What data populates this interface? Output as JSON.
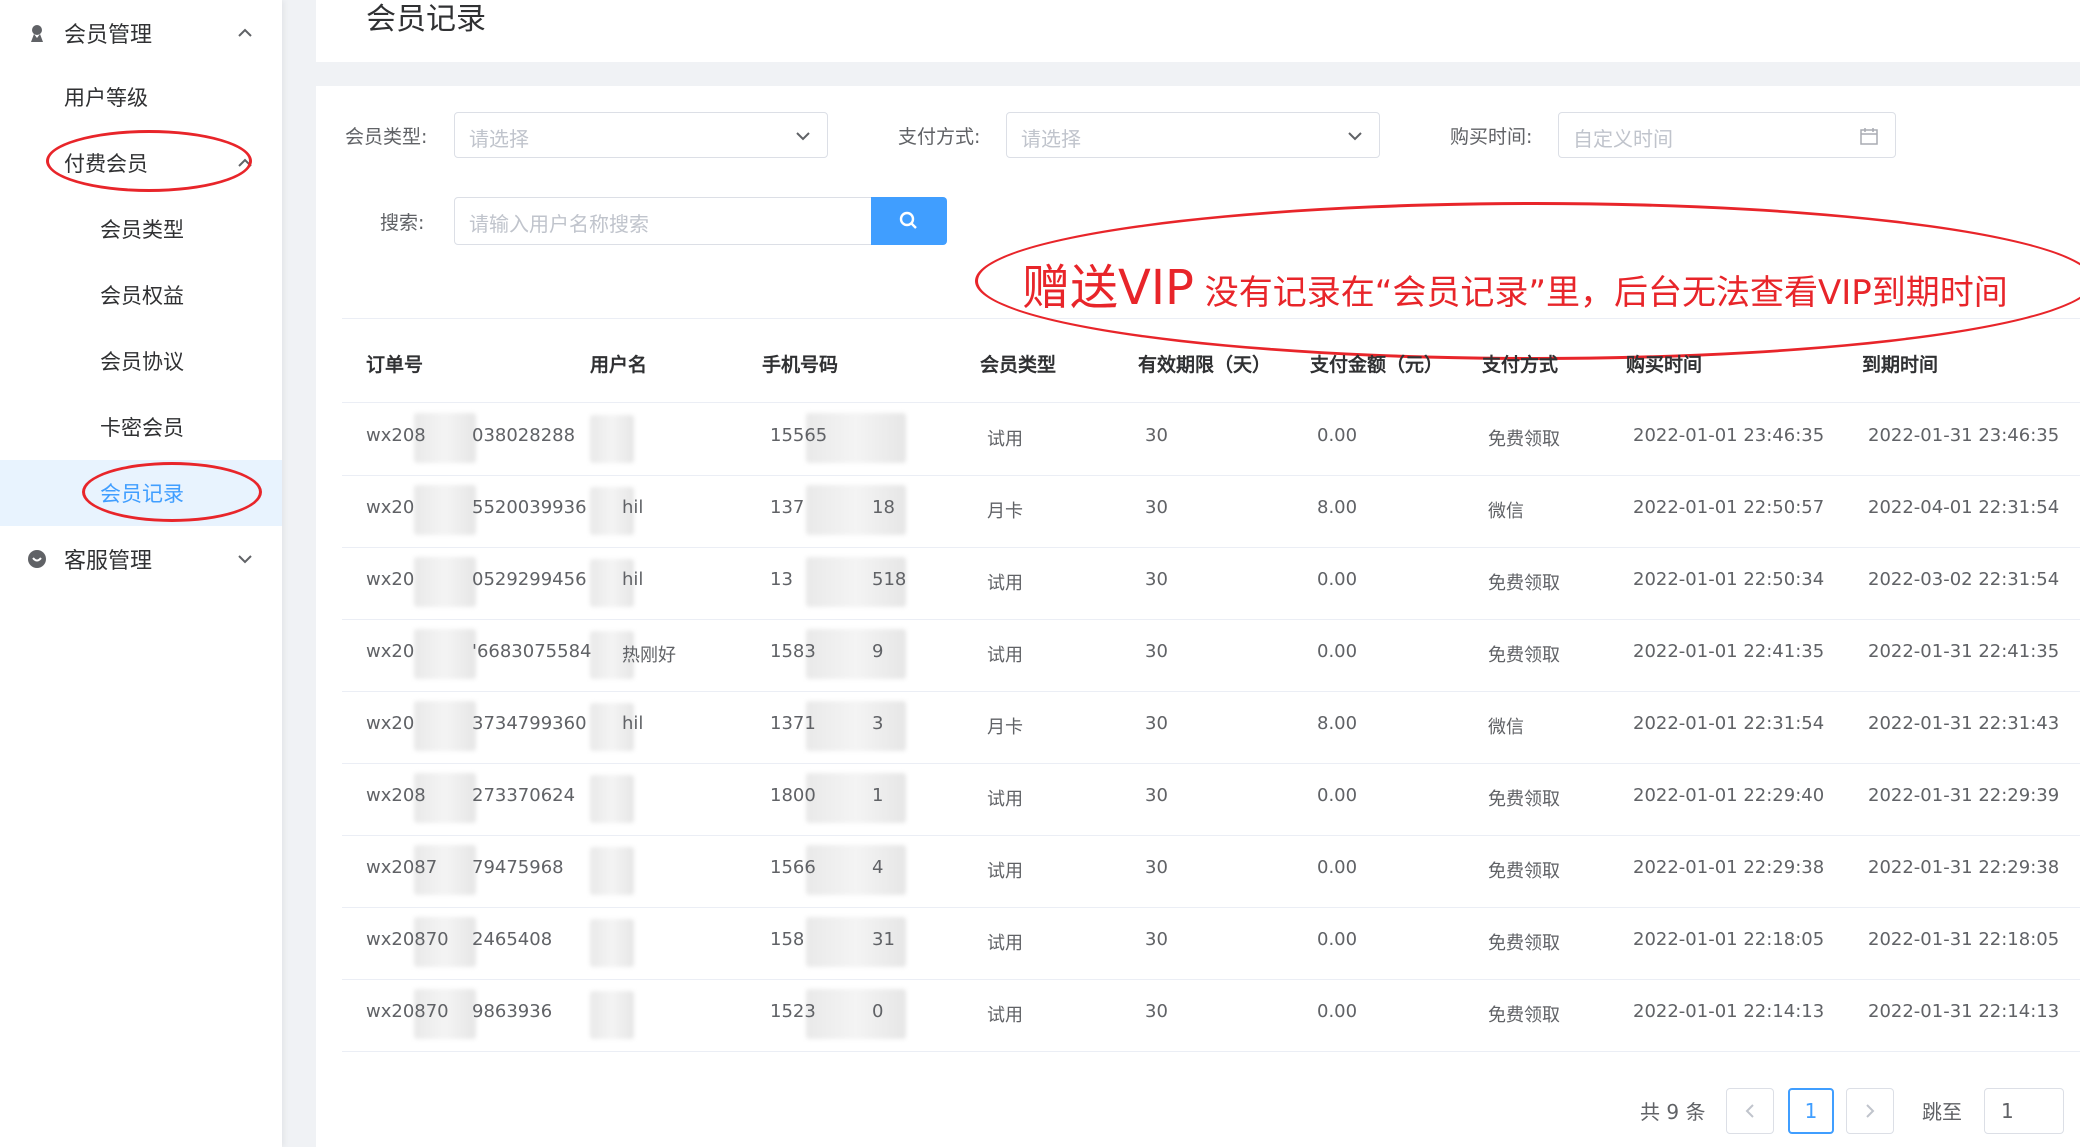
{
  "sidebar": {
    "group_member": {
      "label": "会员管理",
      "icon": "member-icon"
    },
    "item_user_level": "用户等级",
    "item_paid_member": "付费会员",
    "item_member_type": "会员类型",
    "item_member_rights": "会员权益",
    "item_member_agreement": "会员协议",
    "item_card_member": "卡密会员",
    "item_member_records": "会员记录",
    "group_service": {
      "label": "客服管理",
      "icon": "chat-icon"
    }
  },
  "header": {
    "title": "会员记录"
  },
  "filters": {
    "member_type_label": "会员类型:",
    "member_type_placeholder": "请选择",
    "pay_method_label": "支付方式:",
    "pay_method_placeholder": "请选择",
    "buy_time_label": "购买时间:",
    "buy_time_placeholder": "自定义时间",
    "search_label": "搜索:",
    "search_placeholder": "请输入用户名称搜索"
  },
  "annotation": {
    "big": "赠送VIP",
    "text": "没有记录在“会员记录”里，后台无法查看VIP到期时间"
  },
  "table": {
    "columns": [
      "订单号",
      "用户名",
      "手机号码",
      "会员类型",
      "有效期限（天）",
      "支付金额（元）",
      "支付方式",
      "购买时间",
      "到期时间"
    ],
    "rows": [
      {
        "order": "wx208",
        "order_tail": "038028288",
        "user": "",
        "phone": "15565",
        "phone_tail": "",
        "type": "试用",
        "days": "30",
        "amount": "0.00",
        "pay": "免费领取",
        "buy": "2022-01-01 23:46:35",
        "expire": "2022-01-31 23:46:35"
      },
      {
        "order": "wx20",
        "order_tail": "5520039936",
        "user": "hil",
        "phone": "137",
        "phone_tail": "18",
        "type": "月卡",
        "days": "30",
        "amount": "8.00",
        "pay": "微信",
        "buy": "2022-01-01 22:50:57",
        "expire": "2022-04-01 22:31:54"
      },
      {
        "order": "wx20",
        "order_tail": "0529299456",
        "user": "hil",
        "phone": "13",
        "phone_tail": "518",
        "type": "试用",
        "days": "30",
        "amount": "0.00",
        "pay": "免费领取",
        "buy": "2022-01-01 22:50:34",
        "expire": "2022-03-02 22:31:54"
      },
      {
        "order": "wx20",
        "order_tail": "'6683075584",
        "user": "热刚好",
        "phone": "1583",
        "phone_tail": "9",
        "type": "试用",
        "days": "30",
        "amount": "0.00",
        "pay": "免费领取",
        "buy": "2022-01-01 22:41:35",
        "expire": "2022-01-31 22:41:35"
      },
      {
        "order": "wx20",
        "order_tail": "3734799360",
        "user": "hil",
        "phone": "1371",
        "phone_tail": "3",
        "type": "月卡",
        "days": "30",
        "amount": "8.00",
        "pay": "微信",
        "buy": "2022-01-01 22:31:54",
        "expire": "2022-01-31 22:31:43"
      },
      {
        "order": "wx208",
        "order_tail": "273370624",
        "user": "",
        "phone": "1800",
        "phone_tail": "1",
        "type": "试用",
        "days": "30",
        "amount": "0.00",
        "pay": "免费领取",
        "buy": "2022-01-01 22:29:40",
        "expire": "2022-01-31 22:29:39"
      },
      {
        "order": "wx2087",
        "order_tail": "79475968",
        "user": "",
        "phone": "1566",
        "phone_tail": "4",
        "type": "试用",
        "days": "30",
        "amount": "0.00",
        "pay": "免费领取",
        "buy": "2022-01-01 22:29:38",
        "expire": "2022-01-31 22:29:38"
      },
      {
        "order": "wx20870",
        "order_tail": "2465408",
        "user": "",
        "phone": "158",
        "phone_tail": "31",
        "type": "试用",
        "days": "30",
        "amount": "0.00",
        "pay": "免费领取",
        "buy": "2022-01-01 22:18:05",
        "expire": "2022-01-31 22:18:05"
      },
      {
        "order": "wx20870",
        "order_tail": "9863936",
        "user": "",
        "phone": "1523",
        "phone_tail": "0",
        "type": "试用",
        "days": "30",
        "amount": "0.00",
        "pay": "免费领取",
        "buy": "2022-01-01 22:14:13",
        "expire": "2022-01-31 22:14:13"
      }
    ]
  },
  "pagination": {
    "total": "共 9 条",
    "current": "1",
    "jump_label": "跳至",
    "jump_value": "1"
  },
  "colors": {
    "primary": "#409eff",
    "annotation": "#e8252a",
    "active_bg": "#e8f3fe"
  }
}
